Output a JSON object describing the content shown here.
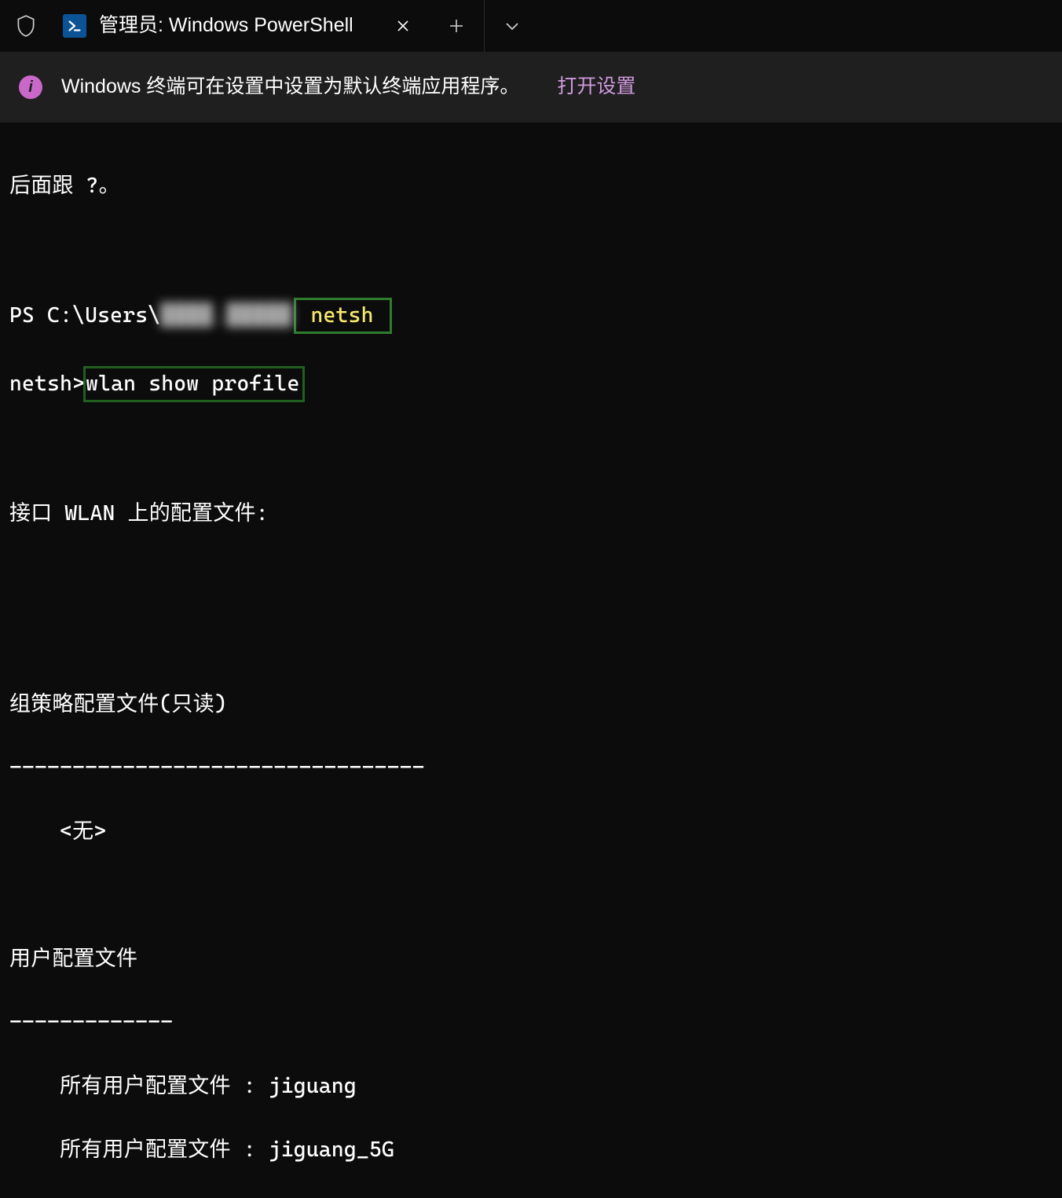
{
  "tab": {
    "title": "管理员: Windows PowerShell",
    "ps_glyph": ">_"
  },
  "infobar": {
    "message": "Windows 终端可在设置中设置为默认终端应用程序。",
    "link_label": "打开设置",
    "info_glyph": "i"
  },
  "term": {
    "line_top": "后面跟 ?。",
    "prompt_prefix": "PS C:\\Users\\",
    "prompt_user_masked": "████.█████",
    "cmd1": "netsh",
    "netsh_prompt": "netsh>",
    "cmd2": "wlan show profile",
    "iface_header": "接口 WLAN 上的配置文件:",
    "gpo_header": "组策略配置文件(只读)",
    "gpo_divider": "---------------------------------",
    "gpo_none": "    <无>",
    "user_header": "用户配置文件",
    "user_divider": "-------------",
    "profile_label": "所有用户配置文件",
    "profiles": [
      "jiguang",
      "jiguang_5G"
    ]
  },
  "colors": {
    "highlight_box_primary": "#2e7d2e",
    "highlight_box_secondary": "#215f21",
    "cmd_yellow": "#f7e96e",
    "link_purple": "#d19adf",
    "info_icon_bg": "#c968c9"
  }
}
